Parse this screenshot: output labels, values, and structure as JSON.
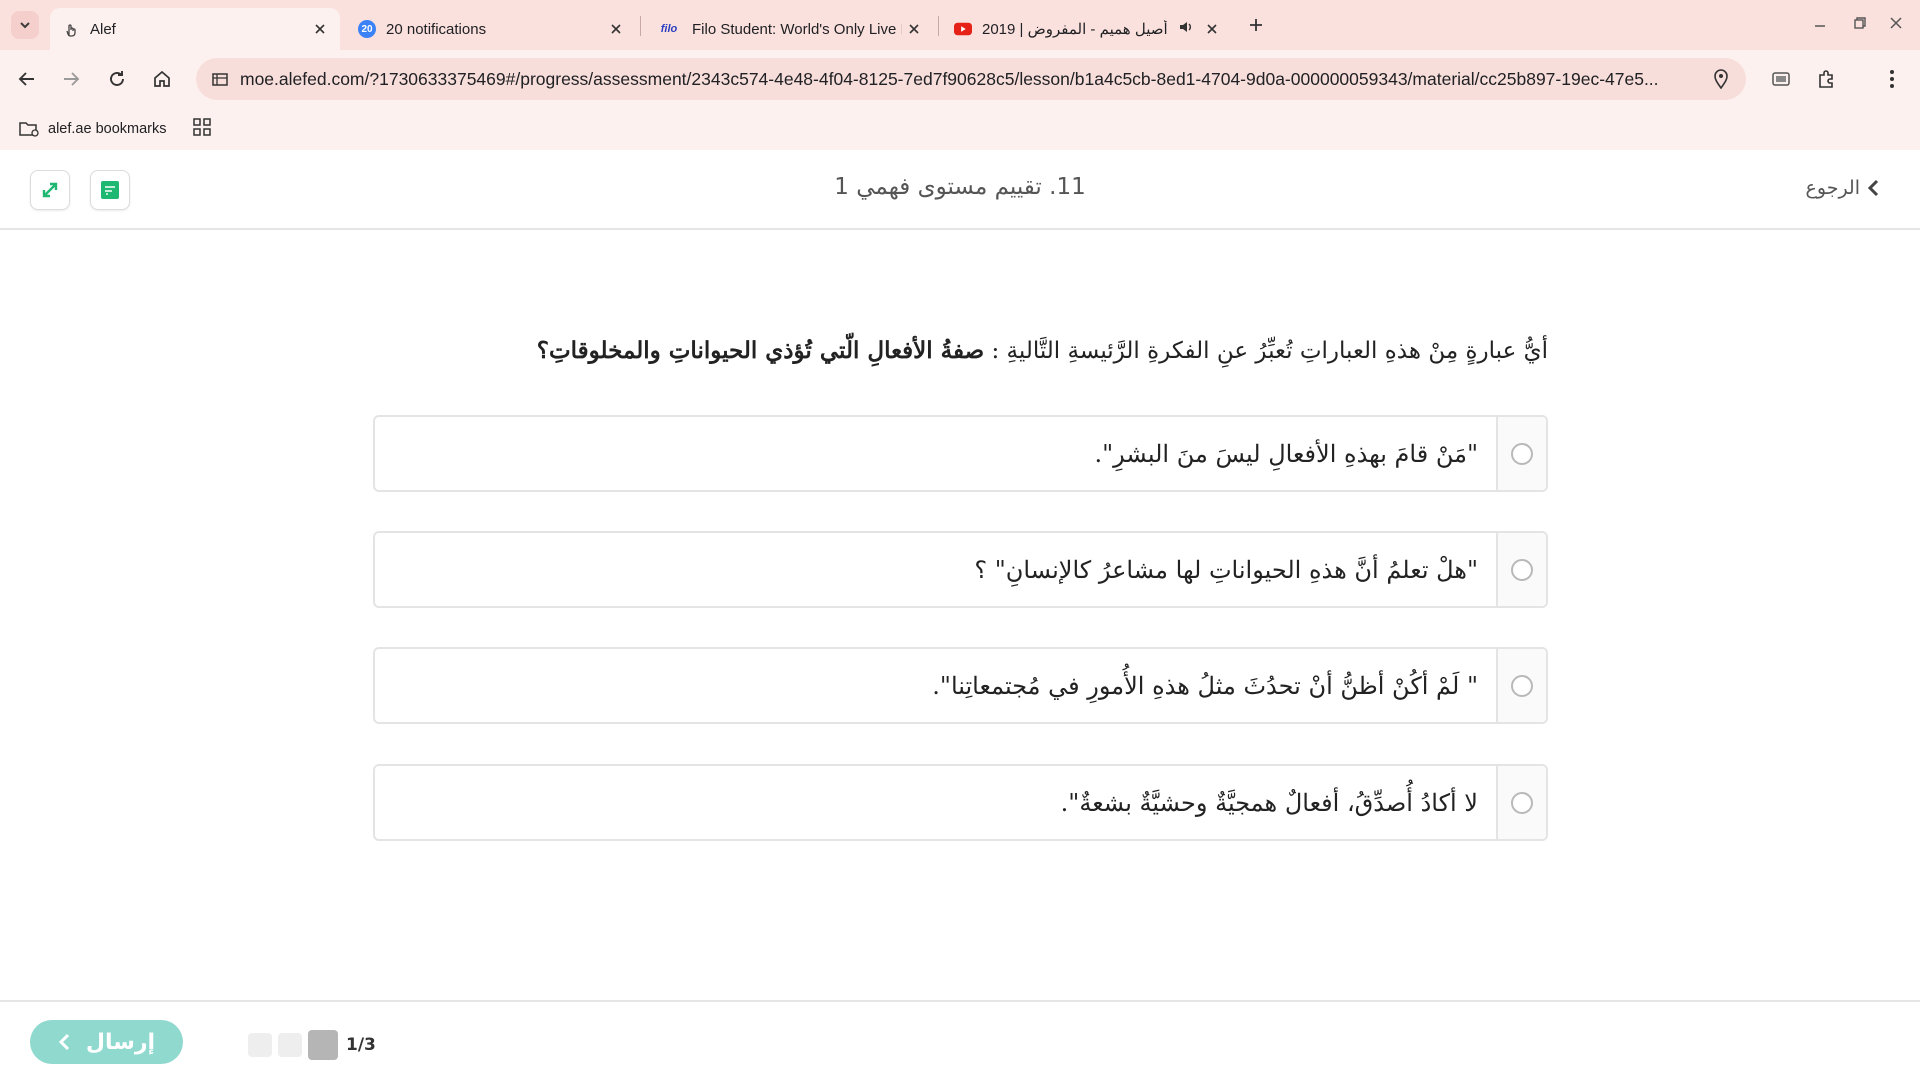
{
  "browser": {
    "tabs": [
      {
        "title": "Alef",
        "active": true
      },
      {
        "title": "20 notifications",
        "badge": "20"
      },
      {
        "title": "Filo Student: World's Only Live I",
        "badge": "filo"
      },
      {
        "title": "2019 | أصيل هميم - المفروض"
      }
    ],
    "url": "moe.alefed.com/?1730633375469#/progress/assessment/2343c574-4e48-4f04-8125-7ed7f90628c5/lesson/b1a4c5cb-8ed1-4704-9d0a-000000059343/material/cc25b897-19ec-47e5...",
    "bookmark_folder": "alef.ae bookmarks"
  },
  "header": {
    "lesson_title": "11. تقييم مستوى فهمي 1",
    "back_label": "الرجوع"
  },
  "question": {
    "prefix": "أيُّ عبارةٍ مِنْ هذهِ العباراتِ تُعبِّرُ عنِ الفكرةِ الرَّئيسةِ التَّاليةِ : ",
    "emphasis": "صفةُ الأفعالِ الّتي تُؤذي الحيواناتِ والمخلوقاتِ؟"
  },
  "options": [
    {
      "text": "\"مَنْ قامَ بهذهِ الأفعالِ ليسَ منَ البشرِ\"."
    },
    {
      "text": "\"هلْ تعلمُ أنَّ هذهِ الحيواناتِ لها مشاعرُ كالإنسانِ\" ؟"
    },
    {
      "text": "\" لَمْ أكُنْ أظنُّ أنْ تحدُثَ مثلُ هذهِ الأُمورِ في مُجتمعاتِنا\"."
    },
    {
      "text": "لا أكادُ أُصدِّقُ، أفعالٌ همجيَّةٌ وحشيَّةٌ بشعةٌ\"."
    }
  ],
  "footer": {
    "submit_label": "إرسال",
    "page_count": "1/3"
  },
  "colors": {
    "submit": "#8fd9cf",
    "accent_green": "#1fb873",
    "tabstrip": "#fbe1de"
  }
}
